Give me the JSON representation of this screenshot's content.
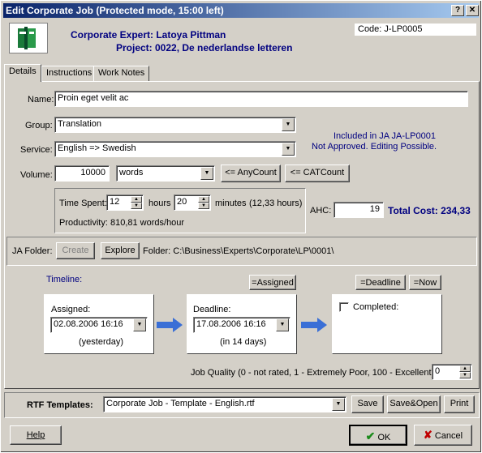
{
  "window": {
    "title": "Edit Corporate Job (Protected mode, 15:00 left)",
    "help_button": "?",
    "close_button": "✕"
  },
  "header": {
    "expert_line": "Corporate Expert: Latoya Pittman",
    "project_line": "Project:  0022, De nederlandse letteren",
    "code": "Code: J-LP0005"
  },
  "tabs": [
    "Details",
    "Instructions",
    "Work Notes"
  ],
  "details": {
    "name_label": "Name:",
    "name_value": "Proin eget velit ac",
    "group_label": "Group:",
    "group_value": "Translation",
    "service_label": "Service:",
    "service_value": "English => Swedish",
    "included_line1": "Included in JA JA-LP0001",
    "included_line2": "Not Approved. Editing Possible.",
    "volume_label": "Volume:",
    "volume_value": "10000",
    "unit_value": "words",
    "anycount_button": "<= AnyCount",
    "catcount_button": "<= CATCount",
    "time_spent_label": "Time Spent:",
    "hours_value": "12",
    "hours_label": "hours",
    "minutes_value": "20",
    "minutes_label": "minutes",
    "time_total": "(12,33 hours)",
    "productivity": "Productivity: 810,81 words/hour",
    "ahc_label": "AHC:",
    "ahc_value": "19",
    "total_cost": "Total Cost: 234,33"
  },
  "ja_folder": {
    "label": "JA Folder:",
    "create_button": "Create",
    "explore_button": "Explore",
    "path": "Folder: C:\\Business\\Experts\\Corporate\\LP\\0001\\"
  },
  "timeline": {
    "title": "Timeline:",
    "assigned_button": "=Assigned",
    "deadline_button": "=Deadline",
    "now_button": "=Now",
    "assigned_label": "Assigned:",
    "assigned_value": "02.08.2006 16:16",
    "assigned_note": "(yesterday)",
    "deadline_label": "Deadline:",
    "deadline_value": "17.08.2006 16:16",
    "deadline_note": "(in 14 days)",
    "completed_label": "Completed:",
    "completed_checked": false
  },
  "quality": {
    "label": "Job Quality (0 - not rated, 1 - Extremely Poor, 100 - Excellent):",
    "value": "0"
  },
  "rtf": {
    "label": "RTF Templates:",
    "template_value": "Corporate Job - Template - English.rtf",
    "save_button": "Save",
    "save_open_button": "Save&Open",
    "print_button": "Print"
  },
  "footer": {
    "help_button": "Help",
    "ok_button": "OK",
    "cancel_button": "Cancel"
  },
  "colors": {
    "title_bar": "#0a246a",
    "label_blue": "#000080",
    "arrow_blue": "#3a6fd6",
    "ok_check": "#1a8a1a",
    "cancel_x": "#c00000"
  }
}
